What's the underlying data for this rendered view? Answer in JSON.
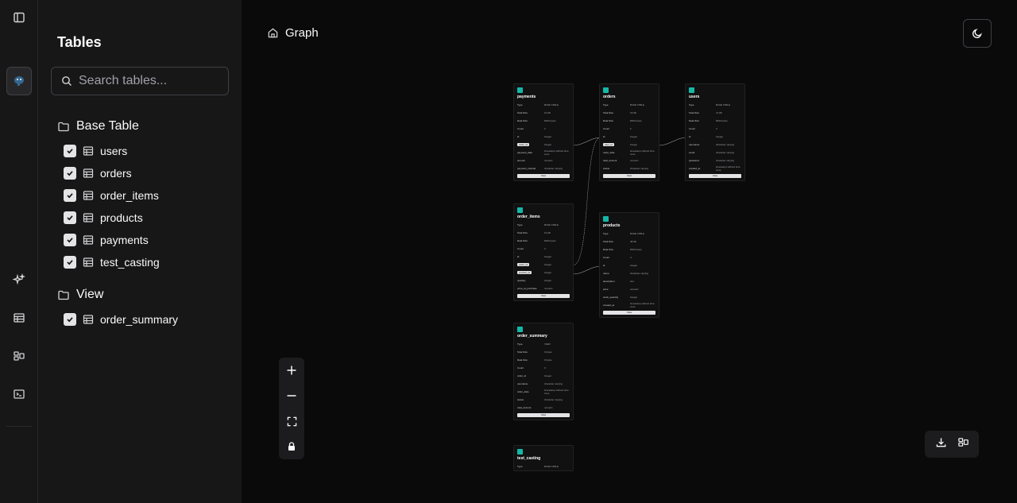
{
  "rail": {
    "toggle_icon": "sidebar-toggle-icon",
    "db_icon": "database-elephant-icon",
    "buttons": [
      "sparkles-icon",
      "table-icon",
      "diagram-icon",
      "terminal-icon"
    ]
  },
  "sidebar": {
    "title": "Tables",
    "search_placeholder": "Search tables...",
    "groups": [
      {
        "label": "Base Table",
        "items": [
          "users",
          "orders",
          "order_items",
          "products",
          "payments",
          "test_casting"
        ]
      },
      {
        "label": "View",
        "items": [
          "order_summary"
        ]
      }
    ]
  },
  "header": {
    "breadcrumb": "Graph"
  },
  "colors": {
    "accent": "#14b8a6",
    "background": "#0a0a0a",
    "panel": "#171717"
  },
  "nodes": {
    "payments": {
      "title": "payments",
      "rows": [
        [
          "Type",
          "BASE TABLE"
        ],
        [
          "Total Size",
          "16 kB"
        ],
        [
          "Data Size",
          "8192 bytes"
        ],
        [
          "Count",
          "2"
        ],
        [
          "id",
          "integer"
        ],
        [
          "order_id",
          "integer"
        ],
        [
          "payment_date",
          "timestamp without time zone"
        ],
        [
          "amount",
          "numeric"
        ],
        [
          "payment_method",
          "character varying"
        ]
      ],
      "button": "View"
    },
    "orders": {
      "title": "orders",
      "rows": [
        [
          "Type",
          "BASE TABLE"
        ],
        [
          "Total Size",
          "16 kB"
        ],
        [
          "Data Size",
          "8192 bytes"
        ],
        [
          "Count",
          "2"
        ],
        [
          "id",
          "integer"
        ],
        [
          "user_id",
          "integer"
        ],
        [
          "order_date",
          "timestamp without time zone"
        ],
        [
          "total_amount",
          "numeric"
        ],
        [
          "status",
          "character varying"
        ]
      ],
      "button": "View"
    },
    "users": {
      "title": "users",
      "rows": [
        [
          "Type",
          "BASE TABLE"
        ],
        [
          "Total Size",
          "72 kB"
        ],
        [
          "Data Size",
          "8192 bytes"
        ],
        [
          "Count",
          "3"
        ],
        [
          "id",
          "integer"
        ],
        [
          "username",
          "character varying"
        ],
        [
          "email",
          "character varying"
        ],
        [
          "password",
          "character varying"
        ],
        [
          "created_at",
          "timestamp without time zone"
        ]
      ],
      "button": "View"
    },
    "order_items": {
      "title": "order_items",
      "rows": [
        [
          "Type",
          "BASE TABLE"
        ],
        [
          "Total Size",
          "16 kB"
        ],
        [
          "Data Size",
          "8192 bytes"
        ],
        [
          "Count",
          "3"
        ],
        [
          "id",
          "integer"
        ],
        [
          "order_id",
          "integer"
        ],
        [
          "product_id",
          "integer"
        ],
        [
          "quantity",
          "integer"
        ],
        [
          "price_at_purchase",
          "numeric"
        ]
      ],
      "button": "View"
    },
    "products": {
      "title": "products",
      "rows": [
        [
          "Type",
          "BASE TABLE"
        ],
        [
          "Total Size",
          "48 kB"
        ],
        [
          "Data Size",
          "8192 bytes"
        ],
        [
          "Count",
          "4"
        ],
        [
          "id",
          "integer"
        ],
        [
          "name",
          "character varying"
        ],
        [
          "description",
          "text"
        ],
        [
          "price",
          "numeric"
        ],
        [
          "stock_quantity",
          "integer"
        ],
        [
          "created_at",
          "timestamp without time zone"
        ]
      ],
      "button": "View"
    },
    "order_summary": {
      "title": "order_summary",
      "rows": [
        [
          "Type",
          "VIEW"
        ],
        [
          "Total Size",
          "0 bytes"
        ],
        [
          "Data Size",
          "0 bytes"
        ],
        [
          "Count",
          "0"
        ],
        [
          "order_id",
          "integer"
        ],
        [
          "username",
          "character varying"
        ],
        [
          "order_date",
          "timestamp without time zone"
        ],
        [
          "status",
          "character varying"
        ],
        [
          "total_amount",
          "numeric"
        ]
      ],
      "button": "View"
    },
    "test_casting": {
      "title": "test_casting",
      "rows": [
        [
          "Type",
          "BASE TABLE"
        ]
      ],
      "button": ""
    }
  }
}
